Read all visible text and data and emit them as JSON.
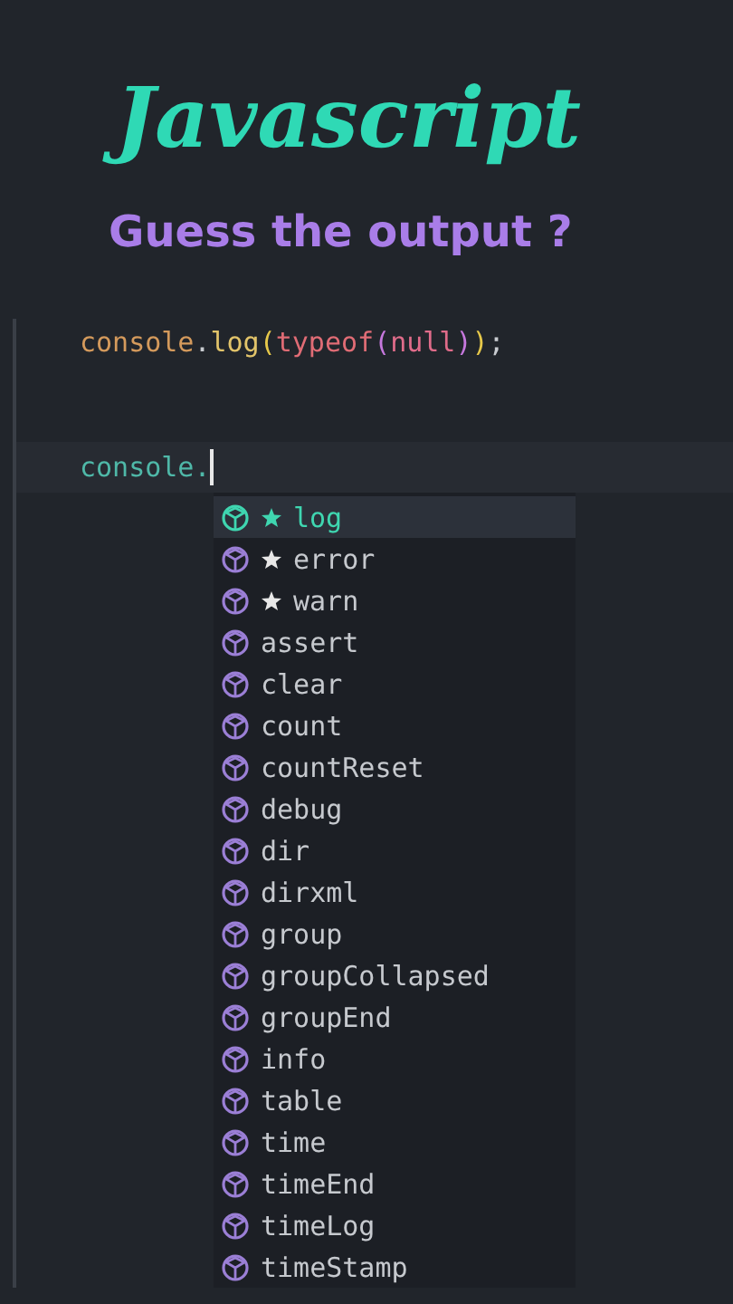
{
  "title": "Javascript",
  "subtitle": "Guess the output ?",
  "code_lines": [
    {
      "tokens": [
        {
          "text": "console",
          "kind": "object"
        },
        {
          "text": ".",
          "kind": "punct"
        },
        {
          "text": "log",
          "kind": "method"
        },
        {
          "text": "(",
          "kind": "paren"
        },
        {
          "text": "typeof",
          "kind": "keyword"
        },
        {
          "text": "(",
          "kind": "paren2"
        },
        {
          "text": "null",
          "kind": "value"
        },
        {
          "text": ")",
          "kind": "paren2"
        },
        {
          "text": ")",
          "kind": "paren"
        },
        {
          "text": ";",
          "kind": "punct"
        }
      ],
      "current": false
    },
    {
      "tokens": [
        {
          "text": "console.",
          "kind": "typing"
        }
      ],
      "current": true
    }
  ],
  "suggestions": [
    {
      "label": "log",
      "starred": true,
      "selected": true
    },
    {
      "label": "error",
      "starred": true,
      "selected": false
    },
    {
      "label": "warn",
      "starred": true,
      "selected": false
    },
    {
      "label": "assert",
      "starred": false,
      "selected": false
    },
    {
      "label": "clear",
      "starred": false,
      "selected": false
    },
    {
      "label": "count",
      "starred": false,
      "selected": false
    },
    {
      "label": "countReset",
      "starred": false,
      "selected": false
    },
    {
      "label": "debug",
      "starred": false,
      "selected": false
    },
    {
      "label": "dir",
      "starred": false,
      "selected": false
    },
    {
      "label": "dirxml",
      "starred": false,
      "selected": false
    },
    {
      "label": "group",
      "starred": false,
      "selected": false
    },
    {
      "label": "groupCollapsed",
      "starred": false,
      "selected": false
    },
    {
      "label": "groupEnd",
      "starred": false,
      "selected": false
    },
    {
      "label": "info",
      "starred": false,
      "selected": false
    },
    {
      "label": "table",
      "starred": false,
      "selected": false
    },
    {
      "label": "time",
      "starred": false,
      "selected": false
    },
    {
      "label": "timeEnd",
      "starred": false,
      "selected": false
    },
    {
      "label": "timeLog",
      "starred": false,
      "selected": false
    },
    {
      "label": "timeStamp",
      "starred": false,
      "selected": false
    }
  ]
}
